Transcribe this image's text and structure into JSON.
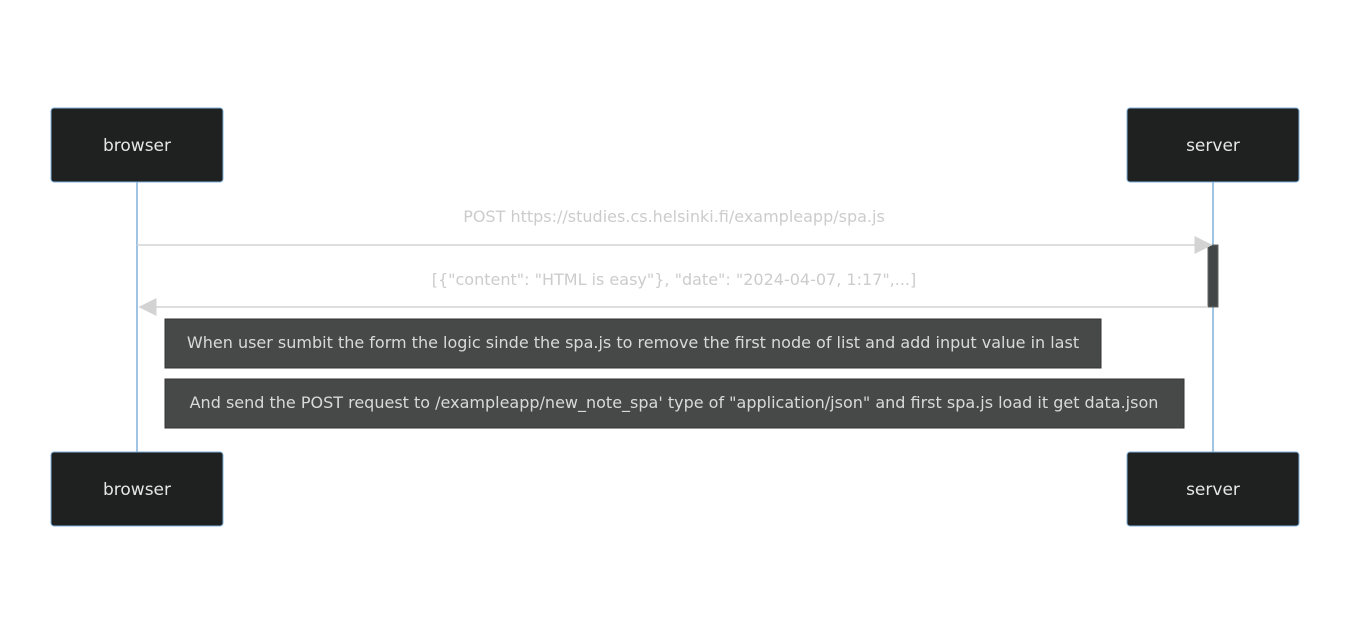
{
  "participants": [
    {
      "id": "browser",
      "label": "browser"
    },
    {
      "id": "server",
      "label": "server"
    }
  ],
  "messages": [
    {
      "from": "browser",
      "to": "server",
      "label": "POST https://studies.cs.helsinki.fi/exampleapp/spa.js",
      "style": "solid"
    },
    {
      "from": "server",
      "to": "browser",
      "label": "[{\"content\": \"HTML is easy\"}, \"date\": \"2024-04-07, 1:17\",...]",
      "style": "solid"
    }
  ],
  "notes": [
    {
      "over": [
        "browser",
        "server"
      ],
      "text": "When user sumbit the form the logic sinde the spa.js to remove the first node of list and add input value in last"
    },
    {
      "over": [
        "browser",
        "server"
      ],
      "text": "And send the POST request to /exampleapp/new_note_spa' type of \"application/json\" and first spa.js load it get data.json"
    }
  ],
  "colors": {
    "actor_fill": "#1f2020",
    "actor_border": "#81b1db",
    "lifeline": "#81b1db",
    "arrow": "#d3d3d3",
    "activation": "#434646",
    "note_fill": "#474949",
    "note_border": "#333333"
  }
}
